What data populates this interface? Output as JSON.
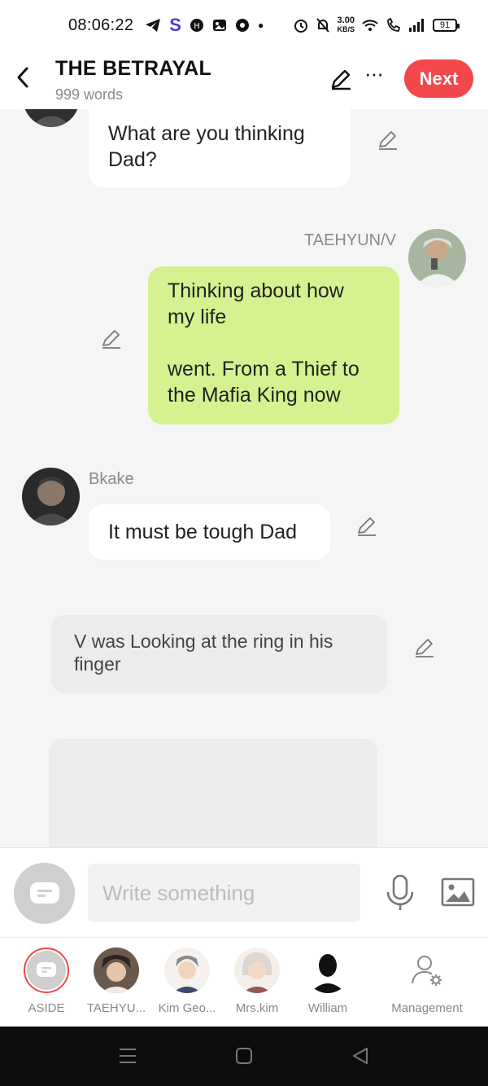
{
  "status_bar": {
    "time": "08:06:22",
    "net_speed_value": "3.00",
    "net_speed_unit": "KB/S",
    "battery": "91"
  },
  "header": {
    "title": "THE BETRAYAL",
    "word_count": "999 words",
    "next_label": "Next"
  },
  "messages": [
    {
      "type": "left",
      "speaker": "",
      "text_lines": [
        "What are you thinking",
        "Dad?"
      ]
    },
    {
      "type": "right",
      "speaker": "TAEHYUN/V",
      "text_lines": [
        "Thinking about how",
        "my life",
        "",
        "went. From a Thief to",
        "the Mafia King now"
      ]
    },
    {
      "type": "left",
      "speaker": "Bkake",
      "text_lines": [
        "It must be tough Dad"
      ]
    },
    {
      "type": "aside",
      "text_lines": [
        "V was Looking at the ring in his",
        "finger"
      ]
    }
  ],
  "input": {
    "placeholder": "Write something"
  },
  "characters": [
    {
      "name": "ASIDE"
    },
    {
      "name": "TAEHYU..."
    },
    {
      "name": "Kim Geo..."
    },
    {
      "name": "Mrs.kim"
    },
    {
      "name": "William"
    },
    {
      "name": "Management"
    }
  ],
  "colors": {
    "accent_red": "#f2474b",
    "green_bubble": "#d4f28f",
    "background": "#f5f5f5"
  }
}
